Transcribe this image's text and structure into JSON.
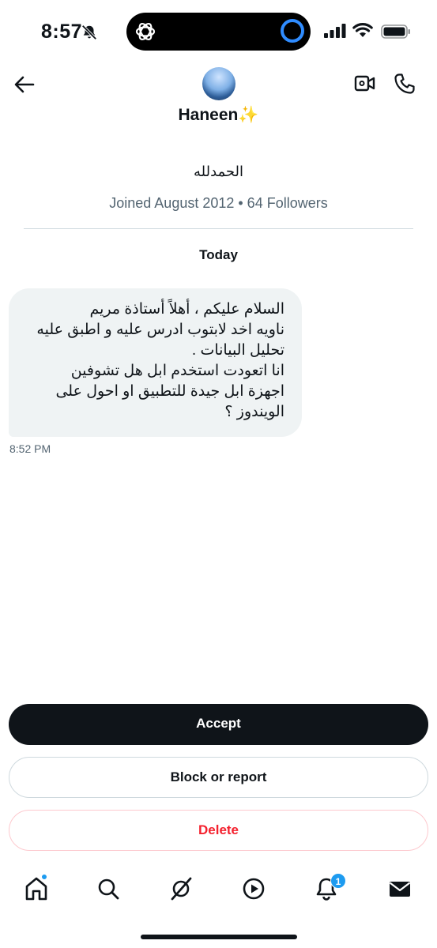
{
  "status_bar": {
    "time": "8:57"
  },
  "header": {
    "display_name": "Haneen",
    "emoji": "✨"
  },
  "profile": {
    "bio": "الحمدلله",
    "meta": "Joined August 2012 • 64 Followers"
  },
  "conversation": {
    "day_label": "Today",
    "messages": [
      {
        "text": "السلام عليكم ، أهلاً أستاذة مريم\nناويه اخد لابتوب ادرس عليه و اطبق عليه\nتحليل البيانات .\nانا اتعودت استخدم ابل هل تشوفين\nاجهزة ابل جيدة للتطبيق او احول على\nالويندوز ؟",
        "time": "8:52 PM"
      }
    ]
  },
  "actions": {
    "accept_label": "Accept",
    "block_label": "Block or report",
    "delete_label": "Delete"
  },
  "tab_bar": {
    "items": [
      "home-icon",
      "search-icon",
      "grok-icon",
      "video-icon",
      "notifications-icon",
      "messages-icon"
    ],
    "notifications_badge": "1"
  },
  "colors": {
    "accent": "#1d9bf0",
    "danger": "#f4212e",
    "text": "#0f1419",
    "muted": "#536471",
    "bubble": "#eff3f4"
  }
}
